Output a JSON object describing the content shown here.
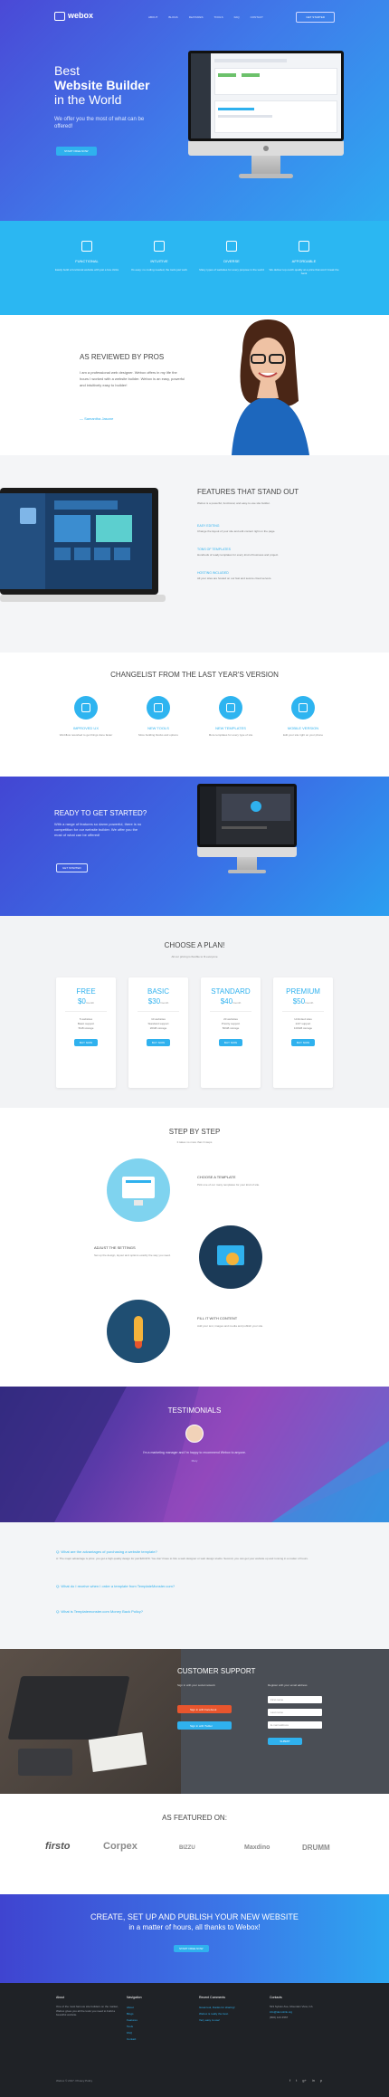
{
  "header": {
    "logo_text": "webox",
    "menu": [
      "ABOUT",
      "BLOGS",
      "FEATURES",
      "TOOLS",
      "FAQ",
      "CONTACT"
    ],
    "cta_label": "GET STARTED"
  },
  "hero": {
    "line1": "Best",
    "line2": "Website Builder",
    "line3": "in the World",
    "subtitle": "We offer you the most of what can be offered!",
    "button": "START FREE NOW"
  },
  "features": [
    {
      "title": "FUNCTIONAL",
      "text": "Easily build a functional website with just a few clicks"
    },
    {
      "title": "INTUITIVE",
      "text": "It's easy: no coding needed, the tools just work"
    },
    {
      "title": "DIVERSE",
      "text": "Many types of websites for every purpose in the world"
    },
    {
      "title": "AFFORDABLE",
      "text": "We deliver top-notch quality at a price that won't break the bank"
    }
  ],
  "reviewed": {
    "title": "AS REVIEWED BY PROS",
    "text": "I am a professional web designer. Webox offers in my life the hours I worked with a website builder. Webox is an easy, powerful and intuitively easy to builder!",
    "author": "— Samantha Jasone"
  },
  "standout": {
    "title": "FEATURES THAT STAND OUT",
    "intro": "Webox is a powerful, functional, and easy-to-use site builder.",
    "items": [
      {
        "title": "EASY EDITING",
        "text": "Change the layout of your site and edit content right on the page."
      },
      {
        "title": "TONS OF TEMPLATES",
        "text": "Hundreds of ready templates for every kind of business and project."
      },
      {
        "title": "HOSTING INCLUDED",
        "text": "All your sites are hosted on our fast and secure cloud servers."
      }
    ]
  },
  "changelist": {
    "title": "CHANGELIST FROM THE LAST YEAR'S VERSION",
    "items": [
      {
        "title": "IMPROVED UX",
        "text": "Workflow reworked to get things done faster"
      },
      {
        "title": "NEW TOOLS",
        "text": "More building blocks and options"
      },
      {
        "title": "NEW TEMPLATES",
        "text": "More templates for every type of site"
      },
      {
        "title": "MOBILE VERSION",
        "text": "Edit your site right on your phone"
      }
    ]
  },
  "ready": {
    "title": "READY TO GET STARTED?",
    "text": "With a range of features so damn powerful, there is no competition for our website builder. We offer you the most of what can be offered!",
    "button": "GET STARTED"
  },
  "pricing": {
    "title": "CHOOSE A PLAN!",
    "subtitle": "All our pricing is flexible to fit everyone",
    "plans": [
      {
        "name": "FREE",
        "price": "$0",
        "period": "/month",
        "f1": "5 websites",
        "f2": "Basic support",
        "f3": "5GB storage",
        "button": "BUY NOW"
      },
      {
        "name": "BASIC",
        "price": "$30",
        "period": "/month",
        "f1": "10 websites",
        "f2": "Standard support",
        "f3": "20GB storage",
        "button": "BUY NOW"
      },
      {
        "name": "STANDARD",
        "price": "$40",
        "period": "/month",
        "f1": "20 websites",
        "f2": "Priority support",
        "f3": "50GB storage",
        "button": "BUY NOW"
      },
      {
        "name": "PREMIUM",
        "price": "$50",
        "period": "/month",
        "f1": "Unlimited sites",
        "f2": "24/7 support",
        "f3": "100GB storage",
        "button": "BUY NOW"
      }
    ]
  },
  "steps": {
    "title": "STEP BY STEP",
    "subtitle": "It takes no more than 3 steps",
    "items": [
      {
        "title": "CHOOSE A TEMPLATE",
        "text": "Pick one of our many templates for your kind of site."
      },
      {
        "title": "ADJUST THE SETTINGS",
        "text": "Set up the design, layout and options exactly the way you need."
      },
      {
        "title": "FILL IT WITH CONTENT",
        "text": "Add your text, images and media and publish your site."
      }
    ]
  },
  "testimonials": {
    "title": "TESTIMONIALS",
    "quote": "I'm a marketing manager and I'm happy to recommend Webox to anyone.",
    "name": "Mary"
  },
  "faq": [
    {
      "q": "Q: What are the advantages of purchasing a website template?",
      "a": "A: The major advantage is price: you get a high quality design for just $20-$70. You don't have to hire a web designer or web design studio. Second, you can get your website up and running in a matter of hours."
    },
    {
      "q": "Q: What do I receive when I order a template from TemplateMonster.com?",
      "a": ""
    },
    {
      "q": "Q: What is Templatemonster.com Money Back Policy?",
      "a": ""
    }
  ],
  "support": {
    "title": "CUSTOMER SUPPORT",
    "col1": "Sign in with your social network",
    "col2": "Register with your email address",
    "fb": "Sign in with Facebook",
    "tw": "Sign in with Twitter",
    "fields": [
      "First name",
      "Last name",
      "E-mail address"
    ],
    "submit": "SUBMIT"
  },
  "featured": {
    "title": "AS FEATURED ON:",
    "brands": [
      "firsto",
      "Corpex",
      "BIZZU",
      "Maxdino",
      "DRUMM"
    ]
  },
  "cta": {
    "line1": "CREATE, SET UP AND PUBLISH YOUR NEW WEBSITE",
    "line2": "in a matter of hours, all thanks to Webox!",
    "button": "START FREE NOW"
  },
  "footer": {
    "about_title": "About",
    "about_text": "One of the most famous site builders on the market, Webox gives you all the tools you need to build a beautiful website.",
    "nav_title": "Navigation",
    "nav_links": [
      "About",
      "Blogs",
      "Features",
      "Tools",
      "FAQ",
      "Contact"
    ],
    "news_title": "Recent Comments",
    "news": [
      "Great tool, thanks for sharing!",
      "Webox is really the best.",
      "Very easy to use!"
    ],
    "contact_title": "Contacts",
    "contact": [
      "523 Sylvan Ave, Mountain View, CA",
      "info@demolink.org",
      "(800) 123 4567"
    ],
    "copyright": "Webox © 2017. Privacy Policy",
    "social": [
      "f",
      "t",
      "g+",
      "in",
      "p"
    ]
  }
}
